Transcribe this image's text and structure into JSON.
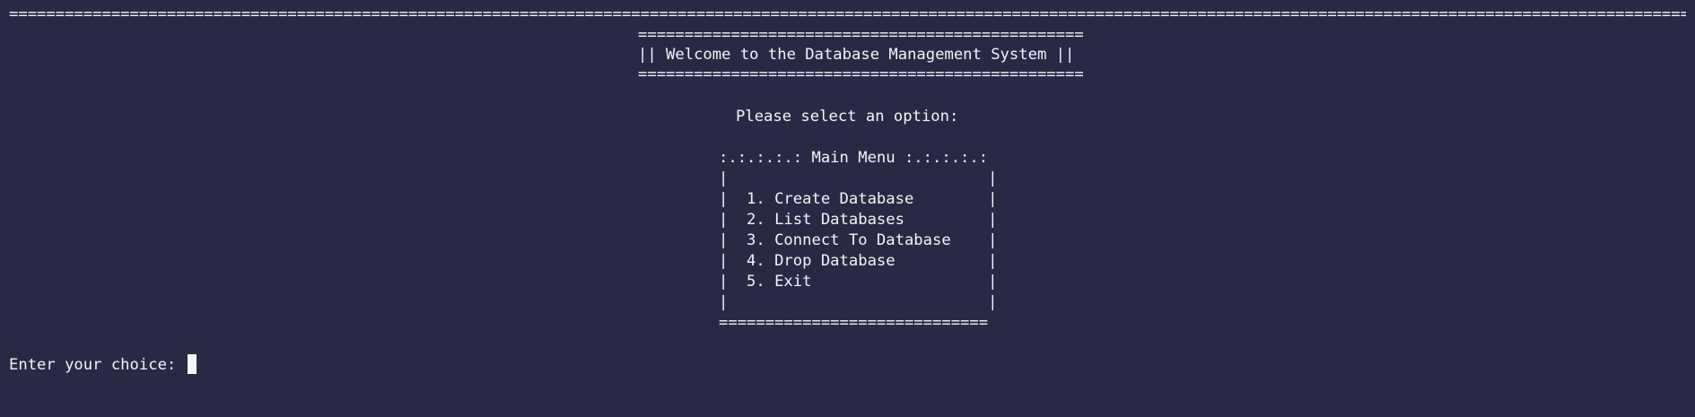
{
  "terminal": {
    "top_rule": "=============================================================================================================================================================================================",
    "banner": {
      "rule_top": "================================================",
      "title": "|| Welcome to the Database Management System ||",
      "rule_bottom": "================================================"
    },
    "prompt_select": "Please select an option:",
    "menu": {
      "header": ":.:.:.:.: Main Menu :.:.:.:.:",
      "blank_top": "|                            |",
      "items": [
        "|  1. Create Database        |",
        "|  2. List Databases         |",
        "|  3. Connect To Database    |",
        "|  4. Drop Database          |",
        "|  5. Exit                   |"
      ],
      "blank_bottom": "|                            |",
      "footer": "============================="
    },
    "input_prompt": "Enter your choice: "
  }
}
